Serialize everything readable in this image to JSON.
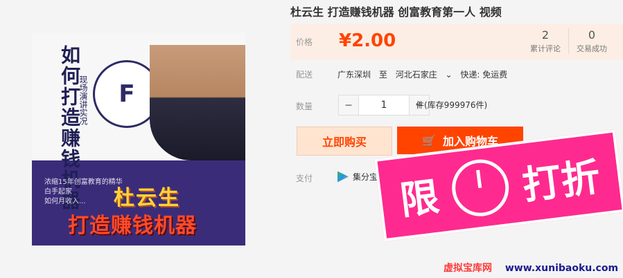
{
  "product": {
    "title": "杜云生 打造赚钱机器 创富教育第一人 视频",
    "image": {
      "title_vertical": "如何打造赚钱机器",
      "subtitle_vertical": "现场演讲实况",
      "badge_text": "F",
      "info_lines": [
        "浓缩15年创富教育的精华",
        "白手起家",
        "如何月收入..."
      ],
      "name": "杜云生",
      "machine_text": "打造赚钱机器"
    }
  },
  "price": {
    "label": "价格",
    "value": "¥2.00"
  },
  "stats": {
    "reviews": {
      "value": "2",
      "label": "累计评论"
    },
    "sales": {
      "value": "0",
      "label": "交易成功"
    }
  },
  "shipping": {
    "label": "配送",
    "from": "广东深圳",
    "to_word": "至",
    "to": "河北石家庄",
    "express": "快递: 免运费"
  },
  "quantity": {
    "label": "数量",
    "value": "1",
    "minus": "−",
    "plus": "+",
    "stock": "件(库存999976件)"
  },
  "buttons": {
    "buy_now": "立即购买",
    "add_cart": "加入购物车"
  },
  "payment": {
    "label": "支付",
    "method": "集分宝"
  },
  "promo": {
    "left": "限",
    "right": "打折"
  },
  "watermark": {
    "site": "虚拟宝库网",
    "domain": "www.xunibaoku.com"
  },
  "colors": {
    "accent": "#ff4400",
    "promo": "#ff2a8f"
  }
}
